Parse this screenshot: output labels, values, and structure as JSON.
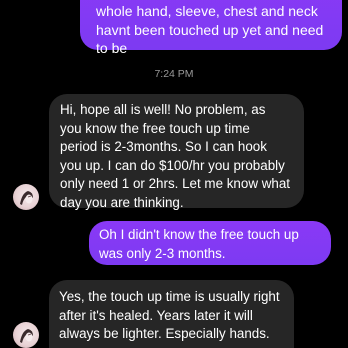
{
  "messages": [
    {
      "direction": "outgoing",
      "text": "whole hand, sleeve, chest and neck havnt been touched up yet and need to be"
    },
    {
      "direction": "incoming",
      "text": "Hi, hope all is well! No problem, as you know the free touch up time period is 2-3months. So I can hook you up. I can do $100/hr you probably only need 1 or 2hrs. Let me know what day you are thinking."
    },
    {
      "direction": "outgoing",
      "text": "Oh I didn't know the free touch up was only 2-3 months."
    },
    {
      "direction": "incoming",
      "text": "Yes, the touch up time is usually right after it's healed. Years later it will always be lighter. Especially hands."
    }
  ],
  "timestamp": "7:24 PM",
  "colors": {
    "background": "#000000",
    "outgoing_bubble": "#8a39f6",
    "incoming_bubble": "#262626",
    "timestamp_text": "#9a9a9a"
  }
}
